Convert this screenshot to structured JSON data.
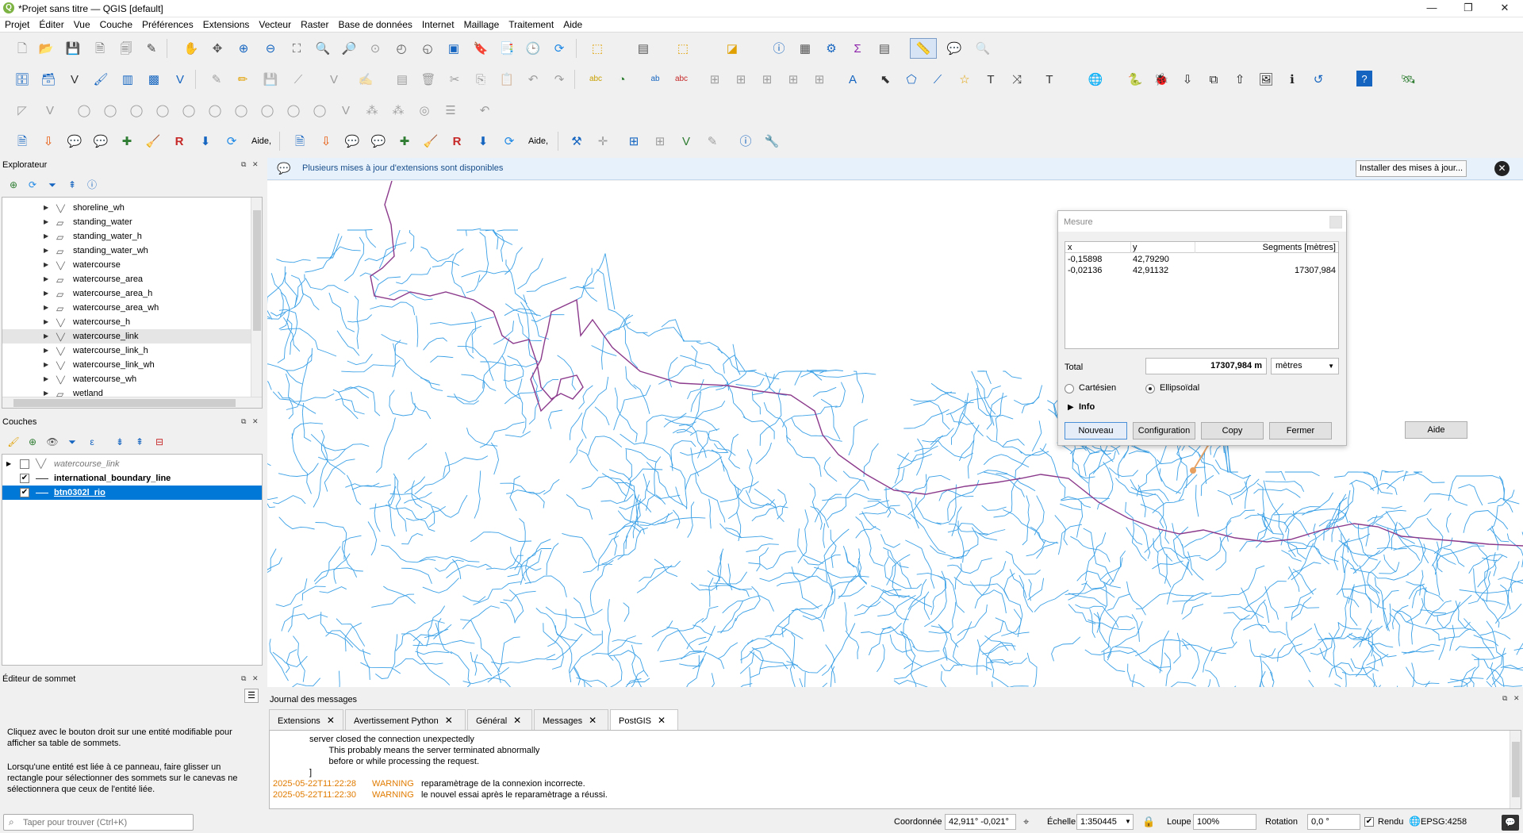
{
  "window": {
    "title": "*Projet sans titre — QGIS [default]",
    "logo_letter": "Q",
    "minimize": "—",
    "maximize": "❐",
    "close": "✕"
  },
  "menu": [
    "Projet",
    "Éditer",
    "Vue",
    "Couche",
    "Préférences",
    "Extensions",
    "Vecteur",
    "Raster",
    "Base de données",
    "Internet",
    "Maillage",
    "Traitement",
    "Aide"
  ],
  "toolbar4": {
    "help_label_1": "Aide,",
    "help_label_2": "Aide,"
  },
  "browser": {
    "title": "Explorateur",
    "items": [
      {
        "label": "shoreline_wh",
        "icon": "line-layer-icon"
      },
      {
        "label": "standing_water",
        "icon": "polygon-layer-icon"
      },
      {
        "label": "standing_water_h",
        "icon": "polygon-layer-icon"
      },
      {
        "label": "standing_water_wh",
        "icon": "polygon-layer-icon"
      },
      {
        "label": "watercourse",
        "icon": "line-layer-icon"
      },
      {
        "label": "watercourse_area",
        "icon": "polygon-layer-icon"
      },
      {
        "label": "watercourse_area_h",
        "icon": "polygon-layer-icon"
      },
      {
        "label": "watercourse_area_wh",
        "icon": "polygon-layer-icon"
      },
      {
        "label": "watercourse_h",
        "icon": "line-layer-icon"
      },
      {
        "label": "watercourse_link",
        "icon": "line-layer-icon"
      },
      {
        "label": "watercourse_link_h",
        "icon": "line-layer-icon"
      },
      {
        "label": "watercourse_link_wh",
        "icon": "line-layer-icon"
      },
      {
        "label": "watercourse_wh",
        "icon": "line-layer-icon"
      },
      {
        "label": "wetland",
        "icon": "polygon-layer-icon"
      }
    ],
    "selected_index": 9
  },
  "layers": {
    "title": "Couches",
    "items": [
      {
        "label": "watercourse_link",
        "checked": false,
        "style": "italic-grey"
      },
      {
        "label": "international_boundary_line",
        "checked": true,
        "style": "bold"
      },
      {
        "label": "btn0302l_rio",
        "checked": true,
        "style": "selected"
      }
    ]
  },
  "vertex_editor": {
    "title": "Éditeur de sommet",
    "text1": "Cliquez avec le bouton droit sur une entité modifiable pour afficher sa table de sommets.",
    "text2": "Lorsqu'une entité est liée à ce panneau, faire glisser un rectangle pour sélectionner des sommets sur le canevas ne sélectionnera que ceux de l'entité liée."
  },
  "search": {
    "placeholder": "Taper pour trouver (Ctrl+K)"
  },
  "infobar": {
    "message": "Plusieurs mises à jour d'extensions sont disponibles",
    "button": "Installer des mises à jour..."
  },
  "measure": {
    "title": "Mesure",
    "headers": [
      "x",
      "y",
      "Segments [mètres]"
    ],
    "rows": [
      {
        "x": "-0,15898",
        "y": "42,79290",
        "seg": ""
      },
      {
        "x": "-0,02136",
        "y": "42,91132",
        "seg": "17307,984"
      }
    ],
    "total_label": "Total",
    "total_value": "17307,984 m",
    "unit": "mètres",
    "opt_cartesian": "Cartésien",
    "opt_ellipsoidal": "Ellipsoïdal",
    "info_label": "Info",
    "buttons": [
      "Nouveau",
      "Configuration",
      "Copy",
      "Fermer",
      "Aide"
    ]
  },
  "log": {
    "title": "Journal des messages",
    "tabs": [
      "Extensions",
      "Avertissement Python",
      "Général",
      "Messages",
      "PostGIS"
    ],
    "active_tab": 4,
    "lines": [
      {
        "ts": "",
        "level": "",
        "msg": "server closed the connection unexpectedly"
      },
      {
        "ts": "",
        "level": "",
        "msg": "\tThis probably means the server terminated abnormally"
      },
      {
        "ts": "",
        "level": "",
        "msg": "\tbefore or while processing the request."
      },
      {
        "ts": "",
        "level": "",
        "msg": "]"
      },
      {
        "ts": "2025-05-22T11:22:28",
        "level": "WARNING",
        "msg": "reparamètrage de la connexion incorrecte."
      },
      {
        "ts": "2025-05-22T11:22:30",
        "level": "WARNING",
        "msg": "le nouvel essai après le reparamètrage a réussi."
      }
    ]
  },
  "status": {
    "coord_label": "Coordonnée",
    "coord_value": "42,911° -0,021°",
    "scale_label": "Échelle",
    "scale_value": "1:350445",
    "magnifier_label": "Loupe",
    "magnifier_value": "100%",
    "rotation_label": "Rotation",
    "rotation_value": "0,0 °",
    "render_label": "Rendu",
    "crs": "EPSG:4258"
  },
  "colors": {
    "river": "#3aa0e6",
    "boundary": "#8b3a8b",
    "selection": "#0078d7",
    "warning": "#e07b00"
  }
}
